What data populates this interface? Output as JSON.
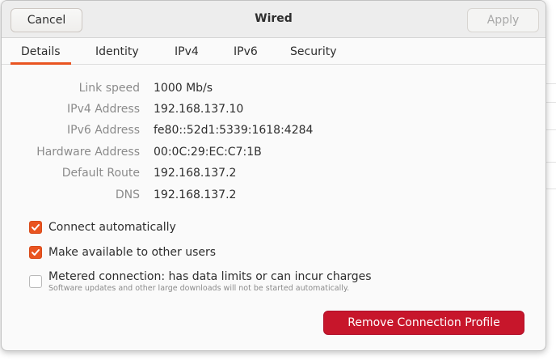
{
  "header": {
    "cancel_label": "Cancel",
    "title": "Wired",
    "apply_label": "Apply"
  },
  "tabs": [
    {
      "label": "Details",
      "active": true
    },
    {
      "label": "Identity",
      "active": false
    },
    {
      "label": "IPv4",
      "active": false
    },
    {
      "label": "IPv6",
      "active": false
    },
    {
      "label": "Security",
      "active": false
    }
  ],
  "details": [
    {
      "label": "Link speed",
      "value": "1000 Mb/s"
    },
    {
      "label": "IPv4 Address",
      "value": "192.168.137.10"
    },
    {
      "label": "IPv6 Address",
      "value": "fe80::52d1:5339:1618:4284"
    },
    {
      "label": "Hardware Address",
      "value": "00:0C:29:EC:C7:1B"
    },
    {
      "label": "Default Route",
      "value": "192.168.137.2"
    },
    {
      "label": "DNS",
      "value": "192.168.137.2"
    }
  ],
  "options": {
    "connect_auto": {
      "label": "Connect automatically",
      "checked": true
    },
    "available_all": {
      "label": "Make available to other users",
      "checked": true
    },
    "metered": {
      "label": "Metered connection: has data limits or can incur charges",
      "sublabel": "Software updates and other large downloads will not be started automatically.",
      "checked": false
    }
  },
  "remove_label": "Remove Connection Profile",
  "colors": {
    "accent": "#e95420",
    "destructive": "#c7162b"
  }
}
